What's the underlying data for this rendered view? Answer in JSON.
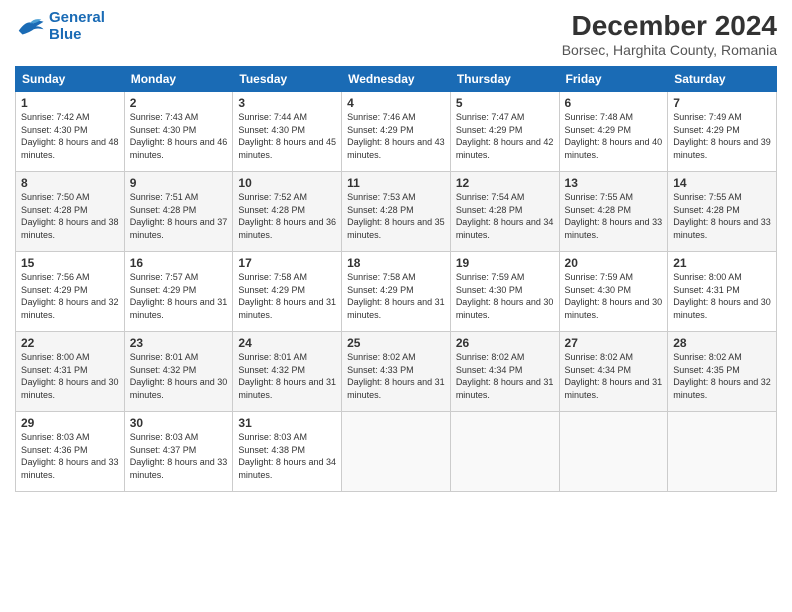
{
  "header": {
    "logo_line1": "General",
    "logo_line2": "Blue",
    "title": "December 2024",
    "subtitle": "Borsec, Harghita County, Romania"
  },
  "days_of_week": [
    "Sunday",
    "Monday",
    "Tuesday",
    "Wednesday",
    "Thursday",
    "Friday",
    "Saturday"
  ],
  "weeks": [
    [
      {
        "day": "1",
        "sunrise": "7:42 AM",
        "sunset": "4:30 PM",
        "daylight": "8 hours and 48 minutes."
      },
      {
        "day": "2",
        "sunrise": "7:43 AM",
        "sunset": "4:30 PM",
        "daylight": "8 hours and 46 minutes."
      },
      {
        "day": "3",
        "sunrise": "7:44 AM",
        "sunset": "4:30 PM",
        "daylight": "8 hours and 45 minutes."
      },
      {
        "day": "4",
        "sunrise": "7:46 AM",
        "sunset": "4:29 PM",
        "daylight": "8 hours and 43 minutes."
      },
      {
        "day": "5",
        "sunrise": "7:47 AM",
        "sunset": "4:29 PM",
        "daylight": "8 hours and 42 minutes."
      },
      {
        "day": "6",
        "sunrise": "7:48 AM",
        "sunset": "4:29 PM",
        "daylight": "8 hours and 40 minutes."
      },
      {
        "day": "7",
        "sunrise": "7:49 AM",
        "sunset": "4:29 PM",
        "daylight": "8 hours and 39 minutes."
      }
    ],
    [
      {
        "day": "8",
        "sunrise": "7:50 AM",
        "sunset": "4:28 PM",
        "daylight": "8 hours and 38 minutes."
      },
      {
        "day": "9",
        "sunrise": "7:51 AM",
        "sunset": "4:28 PM",
        "daylight": "8 hours and 37 minutes."
      },
      {
        "day": "10",
        "sunrise": "7:52 AM",
        "sunset": "4:28 PM",
        "daylight": "8 hours and 36 minutes."
      },
      {
        "day": "11",
        "sunrise": "7:53 AM",
        "sunset": "4:28 PM",
        "daylight": "8 hours and 35 minutes."
      },
      {
        "day": "12",
        "sunrise": "7:54 AM",
        "sunset": "4:28 PM",
        "daylight": "8 hours and 34 minutes."
      },
      {
        "day": "13",
        "sunrise": "7:55 AM",
        "sunset": "4:28 PM",
        "daylight": "8 hours and 33 minutes."
      },
      {
        "day": "14",
        "sunrise": "7:55 AM",
        "sunset": "4:28 PM",
        "daylight": "8 hours and 33 minutes."
      }
    ],
    [
      {
        "day": "15",
        "sunrise": "7:56 AM",
        "sunset": "4:29 PM",
        "daylight": "8 hours and 32 minutes."
      },
      {
        "day": "16",
        "sunrise": "7:57 AM",
        "sunset": "4:29 PM",
        "daylight": "8 hours and 31 minutes."
      },
      {
        "day": "17",
        "sunrise": "7:58 AM",
        "sunset": "4:29 PM",
        "daylight": "8 hours and 31 minutes."
      },
      {
        "day": "18",
        "sunrise": "7:58 AM",
        "sunset": "4:29 PM",
        "daylight": "8 hours and 31 minutes."
      },
      {
        "day": "19",
        "sunrise": "7:59 AM",
        "sunset": "4:30 PM",
        "daylight": "8 hours and 30 minutes."
      },
      {
        "day": "20",
        "sunrise": "7:59 AM",
        "sunset": "4:30 PM",
        "daylight": "8 hours and 30 minutes."
      },
      {
        "day": "21",
        "sunrise": "8:00 AM",
        "sunset": "4:31 PM",
        "daylight": "8 hours and 30 minutes."
      }
    ],
    [
      {
        "day": "22",
        "sunrise": "8:00 AM",
        "sunset": "4:31 PM",
        "daylight": "8 hours and 30 minutes."
      },
      {
        "day": "23",
        "sunrise": "8:01 AM",
        "sunset": "4:32 PM",
        "daylight": "8 hours and 30 minutes."
      },
      {
        "day": "24",
        "sunrise": "8:01 AM",
        "sunset": "4:32 PM",
        "daylight": "8 hours and 31 minutes."
      },
      {
        "day": "25",
        "sunrise": "8:02 AM",
        "sunset": "4:33 PM",
        "daylight": "8 hours and 31 minutes."
      },
      {
        "day": "26",
        "sunrise": "8:02 AM",
        "sunset": "4:34 PM",
        "daylight": "8 hours and 31 minutes."
      },
      {
        "day": "27",
        "sunrise": "8:02 AM",
        "sunset": "4:34 PM",
        "daylight": "8 hours and 31 minutes."
      },
      {
        "day": "28",
        "sunrise": "8:02 AM",
        "sunset": "4:35 PM",
        "daylight": "8 hours and 32 minutes."
      }
    ],
    [
      {
        "day": "29",
        "sunrise": "8:03 AM",
        "sunset": "4:36 PM",
        "daylight": "8 hours and 33 minutes."
      },
      {
        "day": "30",
        "sunrise": "8:03 AM",
        "sunset": "4:37 PM",
        "daylight": "8 hours and 33 minutes."
      },
      {
        "day": "31",
        "sunrise": "8:03 AM",
        "sunset": "4:38 PM",
        "daylight": "8 hours and 34 minutes."
      },
      null,
      null,
      null,
      null
    ]
  ],
  "labels": {
    "sunrise": "Sunrise:",
    "sunset": "Sunset:",
    "daylight": "Daylight:"
  }
}
